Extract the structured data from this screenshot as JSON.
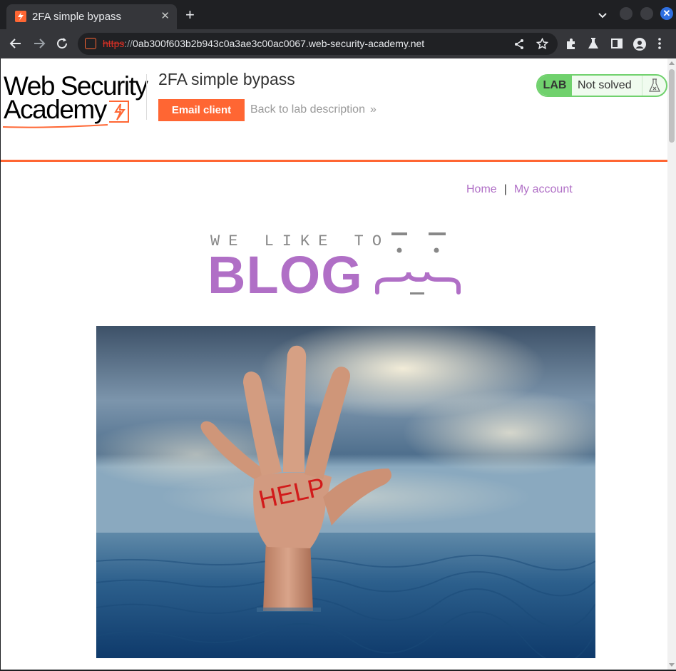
{
  "browser": {
    "tab_title": "2FA simple bypass",
    "new_tab_symbol": "+",
    "close_symbol": "✕",
    "window_close_symbol": "✕",
    "url_scheme": "https",
    "url_separator": "://",
    "url_host": "0ab300f603b2b943c0a3ae3c00ac0067.web-security-academy.net"
  },
  "header": {
    "logo_line1": "Web Security",
    "logo_line2": "Academy",
    "lab_title": "2FA simple bypass",
    "email_client_label": "Email client",
    "back_link_label": "Back to lab description",
    "back_chevrons": "»",
    "lab_badge": "LAB",
    "lab_status": "Not solved"
  },
  "nav": {
    "home": "Home",
    "separator": "|",
    "my_account": "My account"
  },
  "banner": {
    "tagline": "WE LIKE TO",
    "word": "BLOG"
  },
  "hero": {
    "hand_text": "HELP"
  },
  "colors": {
    "accent_orange": "#ff6633",
    "link_purple": "#b06fc6",
    "lab_green": "#70d16d"
  }
}
